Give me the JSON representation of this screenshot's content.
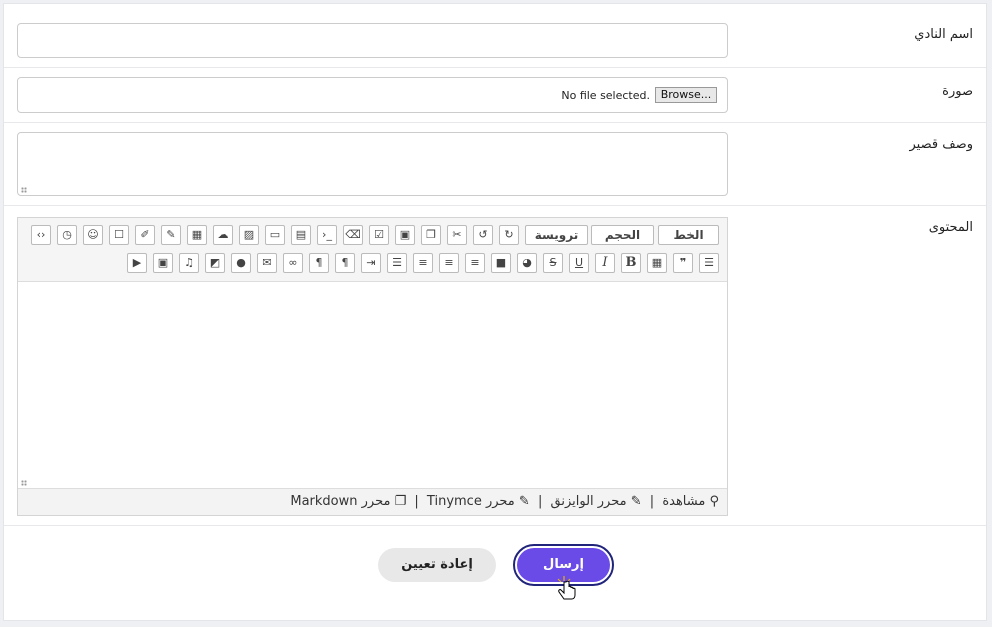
{
  "form": {
    "club_name_label": "اسم النادي",
    "club_name_value": "",
    "image_label": "صورة",
    "file_status": "No file selected.",
    "browse_label": "Browse...",
    "short_desc_label": "وصف قصير",
    "content_label": "المحتوى"
  },
  "editor": {
    "font_label": "الخط",
    "size_label": "الحجم",
    "heading_label": "ترويسة",
    "status_preview": "مشاهدة",
    "status_wysiwyg": "محرر الوايزنق",
    "status_tinymce": "محرر Tinymce",
    "status_markdown": "محرر Markdown",
    "separator": "|"
  },
  "actions": {
    "submit_label": "إرسال",
    "reset_label": "إعادة تعيين"
  },
  "colors": {
    "submit_bg": "#6a4be8",
    "reset_bg": "#e8e8e8"
  }
}
